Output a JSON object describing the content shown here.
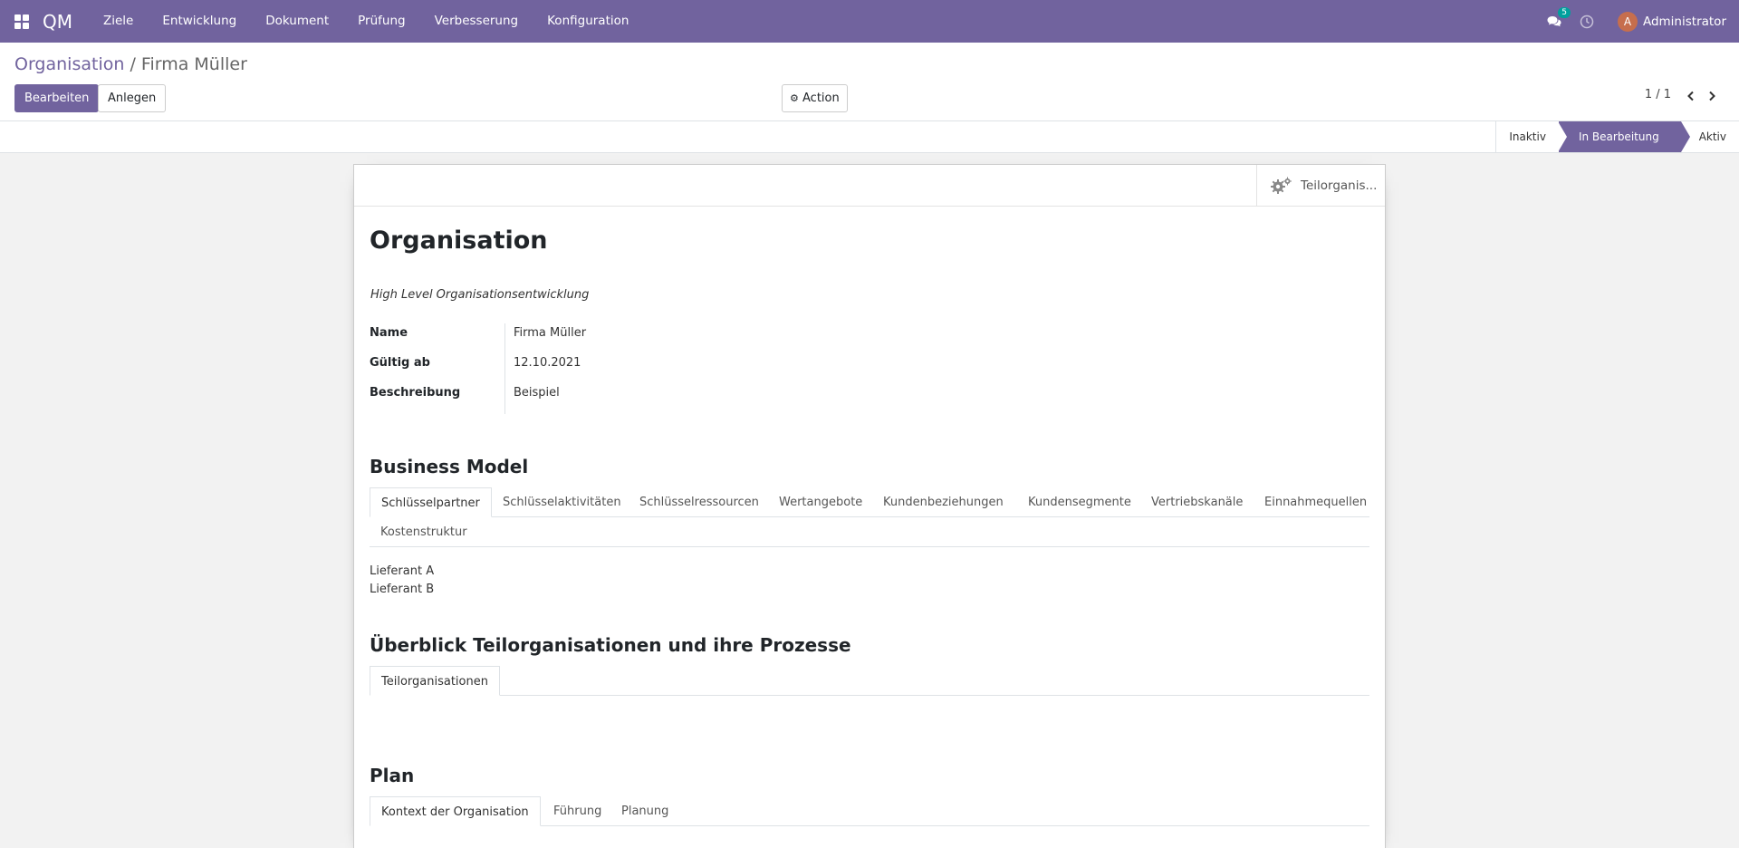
{
  "navbar": {
    "brand": "QM",
    "menu": [
      "Ziele",
      "Entwicklung",
      "Dokument",
      "Prüfung",
      "Verbesserung",
      "Konfiguration"
    ],
    "chat_count": "5",
    "user_initial": "A",
    "user_name": "Administrator",
    "color": "#71639e"
  },
  "breadcrumb": {
    "parent": "Organisation",
    "separator": "/",
    "current": "Firma Müller"
  },
  "toolbar": {
    "edit_label": "Bearbeiten",
    "create_label": "Anlegen",
    "action_label": "Action",
    "pager": "1 / 1"
  },
  "statusbar": {
    "steps": [
      "Inaktiv",
      "In Bearbeitung",
      "Aktiv"
    ],
    "active": "In Bearbeitung"
  },
  "sheet": {
    "smart_button": "Teilorganis...",
    "title": "Organisation",
    "subtitle": "High Level Organisationsentwicklung",
    "fields": [
      {
        "label": "Name",
        "value": "Firma Müller"
      },
      {
        "label": "Gültig ab",
        "value": "12.10.2021"
      },
      {
        "label": "Beschreibung",
        "value": "Beispiel"
      }
    ],
    "business_model": {
      "heading": "Business Model",
      "tabs": [
        "Schlüsselpartner",
        "Schlüsselaktivitäten",
        "Schlüsselressourcen",
        "Wertangebote",
        "Kundenbeziehungen",
        "Kundensegmente",
        "Vertriebskanäle",
        "Einnahmequellen",
        "Kostenstruktur"
      ],
      "content": [
        "Lieferant A",
        "Lieferant B"
      ]
    },
    "overview": {
      "heading": "Überblick Teilorganisationen und ihre Prozesse",
      "tabs": [
        "Teilorganisationen"
      ]
    },
    "plan": {
      "heading": "Plan",
      "tabs": [
        "Kontext der Organisation",
        "Führung",
        "Planung"
      ]
    }
  }
}
